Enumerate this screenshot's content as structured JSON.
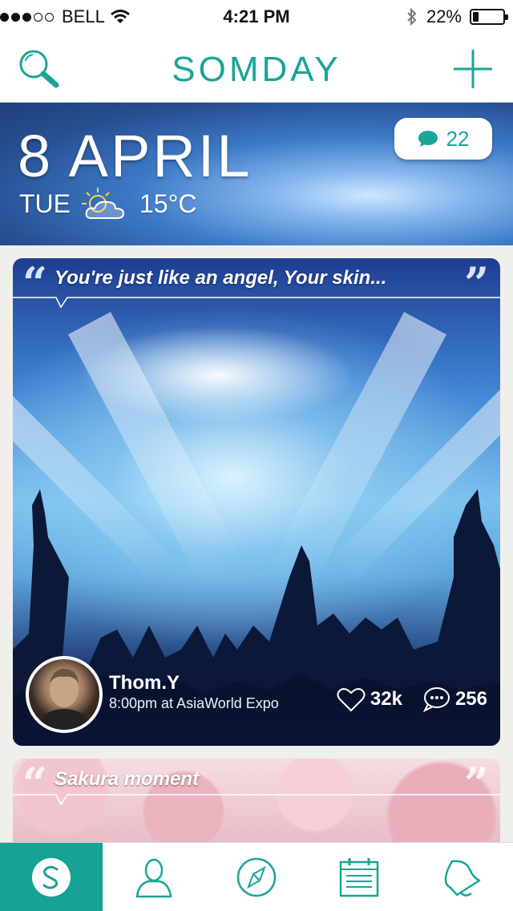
{
  "status_bar": {
    "carrier": "BELL",
    "time": "4:21 PM",
    "battery": "22%",
    "battery_level": 0.22,
    "signal_bars": 3,
    "signal_total": 5
  },
  "nav": {
    "title": "SOMDAY",
    "left_icon": "search-icon",
    "right_icon": "plus-icon"
  },
  "date_header": {
    "date": "8 APRIL",
    "weekday": "TUE",
    "weather_icon": "partly-cloudy-icon",
    "temperature": "15°C",
    "comment_count": "22"
  },
  "posts": [
    {
      "quote": "You're just like an angel, Your skin...",
      "author": "Thom.Y",
      "meta": "8:00pm at AsiaWorld Expo",
      "likes": "32k",
      "comments": "256"
    },
    {
      "quote": "Sakura moment"
    }
  ],
  "tabs": [
    {
      "icon": "somday-logo-icon",
      "active": true
    },
    {
      "icon": "profile-icon",
      "active": false
    },
    {
      "icon": "compass-icon",
      "active": false
    },
    {
      "icon": "calendar-icon",
      "active": false
    },
    {
      "icon": "bell-icon",
      "active": false
    }
  ],
  "colors": {
    "accent": "#1aa597",
    "tab_active": "#16a395"
  }
}
